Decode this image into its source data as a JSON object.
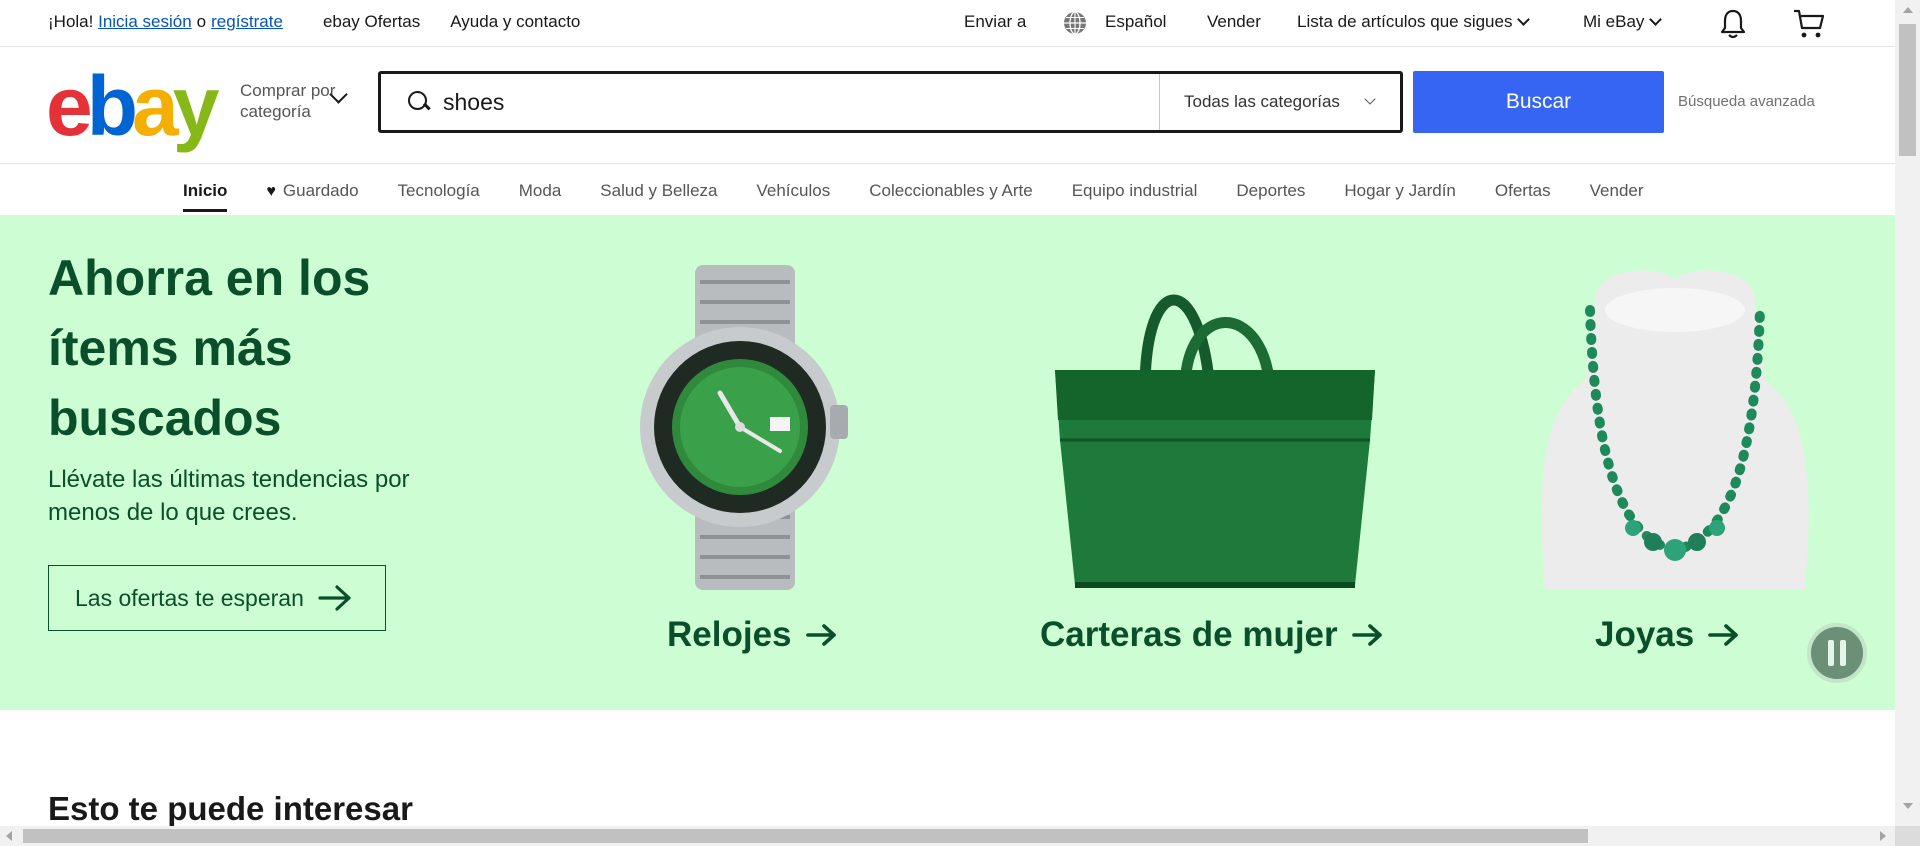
{
  "topbar": {
    "greeting": "¡Hola!",
    "signin": "Inicia sesión",
    "or": "o",
    "register": "regístrate",
    "deals": "ebay Ofertas",
    "help": "Ayuda y contacto",
    "ship_to": "Enviar a",
    "language": "Español",
    "sell": "Vender",
    "watchlist": "Lista de artículos que sigues",
    "my_ebay": "Mi eBay"
  },
  "header": {
    "logo": {
      "e": "e",
      "b": "b",
      "a": "a",
      "y": "y"
    },
    "shop_by_category": [
      "Comprar por",
      "categoría"
    ],
    "search": {
      "value": "shoes",
      "category": "Todas las categorías"
    },
    "search_button": "Buscar",
    "advanced": "Búsqueda avanzada"
  },
  "nav": {
    "items": [
      "Inicio",
      "Guardado",
      "Tecnología",
      "Moda",
      "Salud y Belleza",
      "Vehículos",
      "Coleccionables y Arte",
      "Equipo industrial",
      "Deportes",
      "Hogar y Jardín",
      "Ofertas",
      "Vender"
    ]
  },
  "hero": {
    "title": "Ahorra en los ítems más buscados",
    "subtitle": "Llévate las últimas tendencias por menos de lo que crees.",
    "cta": "Las ofertas te esperan",
    "tiles": [
      "Relojes",
      "Carteras de mujer",
      "Joyas"
    ]
  },
  "section": {
    "title": "Esto te puede interesar"
  },
  "colors": {
    "hero_bg": "#ccfdd3",
    "hero_text": "#0a4f2a",
    "primary": "#3665f3"
  }
}
